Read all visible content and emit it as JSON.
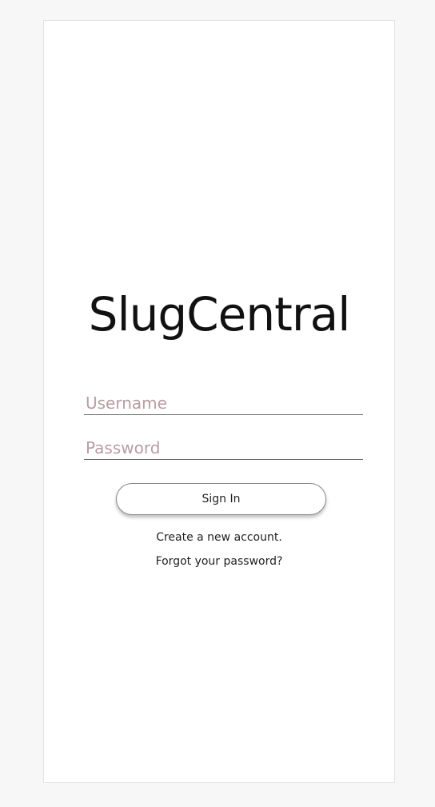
{
  "app": {
    "title": "SlugCentral"
  },
  "login": {
    "username_placeholder": "Username",
    "username_value": "",
    "password_placeholder": "Password",
    "password_value": "",
    "sign_in_label": "Sign In",
    "create_account_label": "Create a new account.",
    "forgot_password_label": "Forgot your password?"
  },
  "colors": {
    "background": "#f7f7f7",
    "card": "#ffffff",
    "placeholder": "#b89ca3",
    "text": "#111111"
  }
}
